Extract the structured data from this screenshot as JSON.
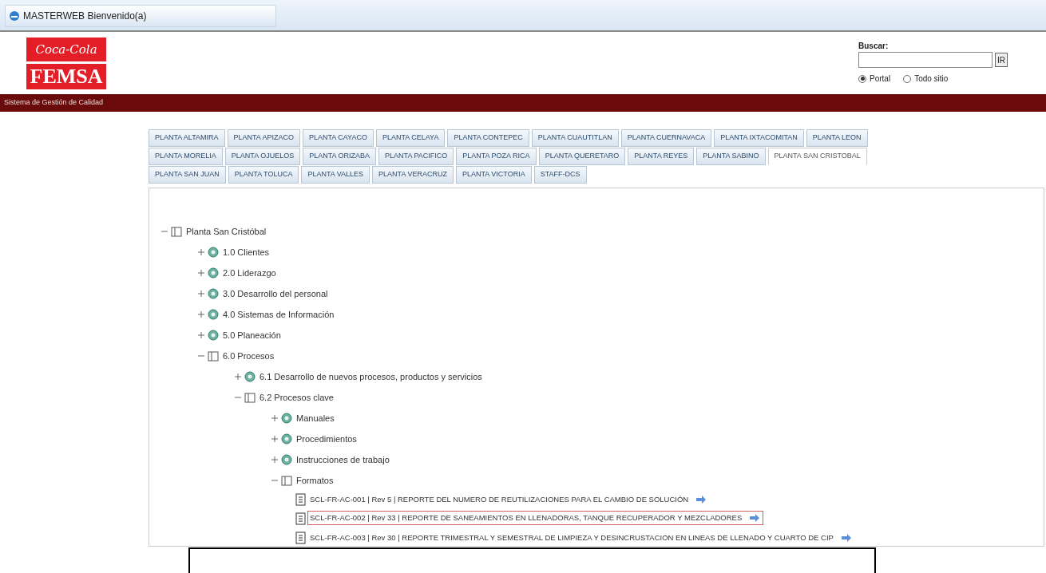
{
  "browser_tab": {
    "title": "MASTERWEB Bienvenido(a)"
  },
  "logo": {
    "line_1": "Coca-Cola",
    "line_2": "FEMSA"
  },
  "search": {
    "label": "Buscar:",
    "button": "IR",
    "scopes": [
      {
        "label": "Portal",
        "selected": true
      },
      {
        "label": "Todo sitio",
        "selected": false
      }
    ]
  },
  "banner": "Sistema de Gestión de Calidad",
  "tab_rows": [
    [
      {
        "label": "PLANTA ALTAMIRA",
        "selected": false
      },
      {
        "label": "PLANTA APIZACO",
        "selected": false
      },
      {
        "label": "PLANTA CAYACO",
        "selected": false
      },
      {
        "label": "PLANTA CELAYA",
        "selected": false
      },
      {
        "label": "PLANTA CONTEPEC",
        "selected": false
      },
      {
        "label": "PLANTA CUAUTITLAN",
        "selected": false
      },
      {
        "label": "PLANTA CUERNAVACA",
        "selected": false
      },
      {
        "label": "PLANTA IXTACOMITAN",
        "selected": false
      },
      {
        "label": "PLANTA LEON",
        "selected": false
      }
    ],
    [
      {
        "label": "PLANTA MORELIA",
        "selected": false
      },
      {
        "label": "PLANTA OJUELOS",
        "selected": false
      },
      {
        "label": "PLANTA ORIZABA",
        "selected": false
      },
      {
        "label": "PLANTA PACIFICO",
        "selected": false
      },
      {
        "label": "PLANTA POZA RICA",
        "selected": false
      },
      {
        "label": "PLANTA QUERETARO",
        "selected": false
      },
      {
        "label": "PLANTA REYES",
        "selected": false
      },
      {
        "label": "PLANTA SABINO",
        "selected": false
      },
      {
        "label": "PLANTA SAN CRISTOBAL",
        "selected": true
      }
    ],
    [
      {
        "label": "PLANTA SAN JUAN",
        "selected": false
      },
      {
        "label": "PLANTA TOLUCA",
        "selected": false
      },
      {
        "label": "PLANTA VALLES",
        "selected": false
      },
      {
        "label": "PLANTA VERACRUZ",
        "selected": false
      },
      {
        "label": "PLANTA VICTORIA",
        "selected": false
      },
      {
        "label": "STAFF-DCS",
        "selected": false
      }
    ]
  ],
  "tree": [
    {
      "kind": "folder",
      "label": "Planta San Cristóbal",
      "expanded": true,
      "children": [
        {
          "kind": "folder",
          "label": "1.0 Clientes",
          "expanded": false
        },
        {
          "kind": "folder",
          "label": "2.0 Liderazgo",
          "expanded": false
        },
        {
          "kind": "folder",
          "label": "3.0 Desarrollo del personal",
          "expanded": false
        },
        {
          "kind": "folder",
          "label": "4.0 Sistemas de Información",
          "expanded": false
        },
        {
          "kind": "folder",
          "label": "5.0 Planeación",
          "expanded": false
        },
        {
          "kind": "folder",
          "label": "6.0 Procesos",
          "expanded": true,
          "children": [
            {
              "kind": "folder",
              "label": "6.1 Desarrollo de nuevos procesos, productos y servicios",
              "expanded": false
            },
            {
              "kind": "folder",
              "label": "6.2 Procesos clave",
              "expanded": true,
              "children": [
                {
                  "kind": "folder",
                  "label": "Manuales",
                  "expanded": false
                },
                {
                  "kind": "folder",
                  "label": "Procedimientos",
                  "expanded": false
                },
                {
                  "kind": "folder",
                  "label": "Instrucciones de trabajo",
                  "expanded": false
                },
                {
                  "kind": "folder",
                  "label": "Formatos",
                  "expanded": true,
                  "children": [
                    {
                      "kind": "document",
                      "label": "SCL-FR-AC-001 | Rev 5 | REPORTE DEL NUMERO DE REUTILIZACIONES PARA EL CAMBIO DE SOLUCIÓN",
                      "selected": false
                    },
                    {
                      "kind": "document",
                      "label": "SCL-FR-AC-002 | Rev 33 | REPORTE DE SANEAMIENTOS EN LLENADORAS, TANQUE RECUPERADOR Y MEZCLADORES",
                      "selected": true
                    },
                    {
                      "kind": "document",
                      "label": "SCL-FR-AC-003 | Rev 30 | REPORTE TRIMESTRAL Y SEMESTRAL DE LIMPIEZA Y DESINCRUSTACION EN LINEAS DE LLENADO Y CUARTO DE CIP",
                      "selected": false
                    }
                  ]
                }
              ]
            }
          ]
        }
      ]
    }
  ]
}
